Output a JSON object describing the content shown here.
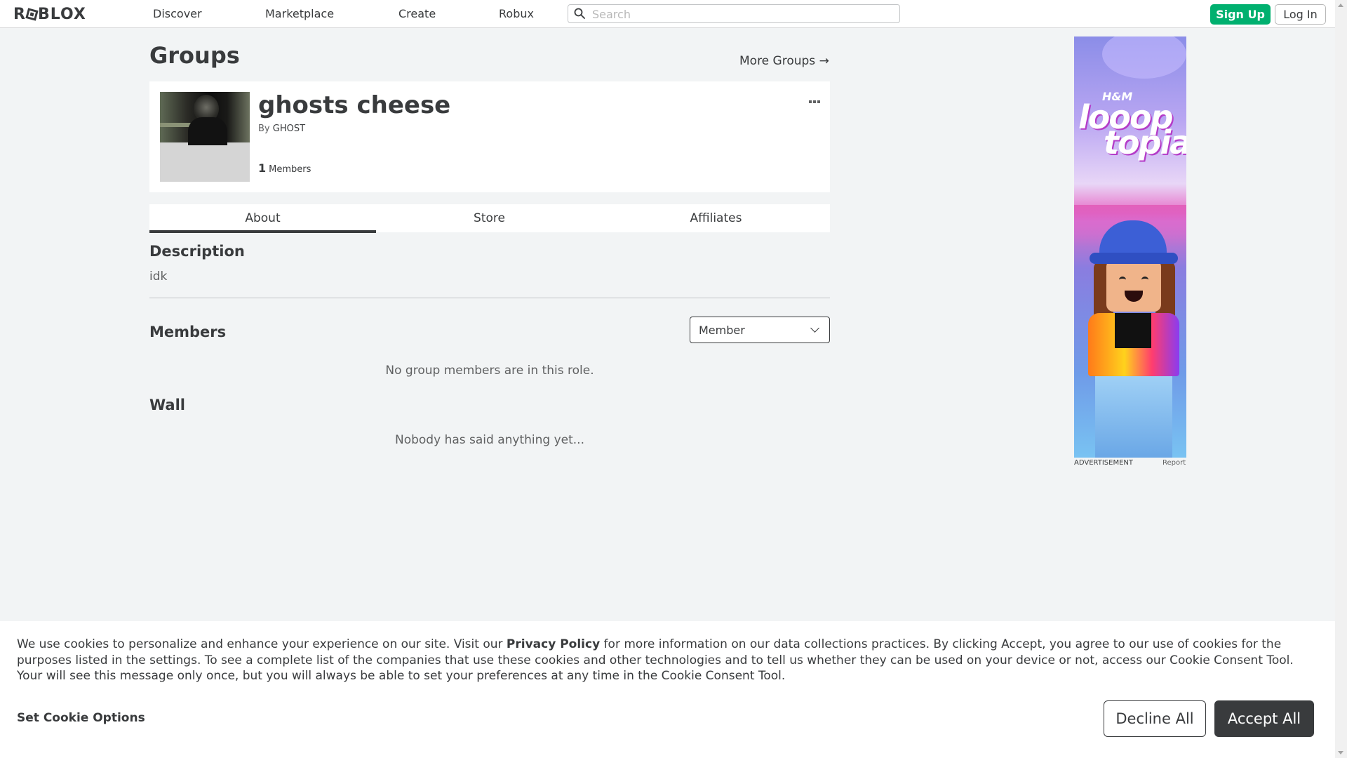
{
  "nav": {
    "logo": "ROBLOX",
    "logo_parts": [
      "R",
      "BLOX"
    ],
    "links": [
      "Discover",
      "Marketplace",
      "Create",
      "Robux"
    ],
    "search_placeholder": "Search",
    "signup_label": "Sign Up",
    "login_label": "Log In"
  },
  "page": {
    "title": "Groups",
    "more_groups": "More Groups →"
  },
  "group": {
    "name": "ghosts cheese",
    "by_label": "By",
    "owner": "GHOST",
    "member_count": "1",
    "members_label": "Members"
  },
  "tabs": [
    "About",
    "Store",
    "Affiliates"
  ],
  "about": {
    "description_title": "Description",
    "description": "idk",
    "members_title": "Members",
    "role_selected": "Member",
    "members_empty": "No group members are in this role.",
    "wall_title": "Wall",
    "wall_empty": "Nobody has said anything yet..."
  },
  "ad": {
    "brand_small": "H&M",
    "logo_line1": "looop",
    "logo_line2": "topia",
    "label": "ADVERTISEMENT",
    "report": "Report"
  },
  "cookie": {
    "text_before": "We use cookies to personalize and enhance your experience on our site. Visit our ",
    "privacy_link": "Privacy Policy",
    "text_after": " for more information on our data collections practices. By clicking Accept, you agree to our use of cookies for the purposes listed in the settings. To see a complete list of the companies that use these cookies and other technologies and to tell us whether they can be used on your device or not, access our Cookie Consent Tool. Your will see this message only once, but you will always be able to set your preferences at any time in the Cookie Consent Tool.",
    "options_label": "Set Cookie Options",
    "decline_label": "Decline All",
    "accept_label": "Accept All"
  },
  "colors": {
    "signup_green": "#00b06f",
    "text_dark": "#393b3d",
    "page_bg": "#f2f4f5"
  }
}
